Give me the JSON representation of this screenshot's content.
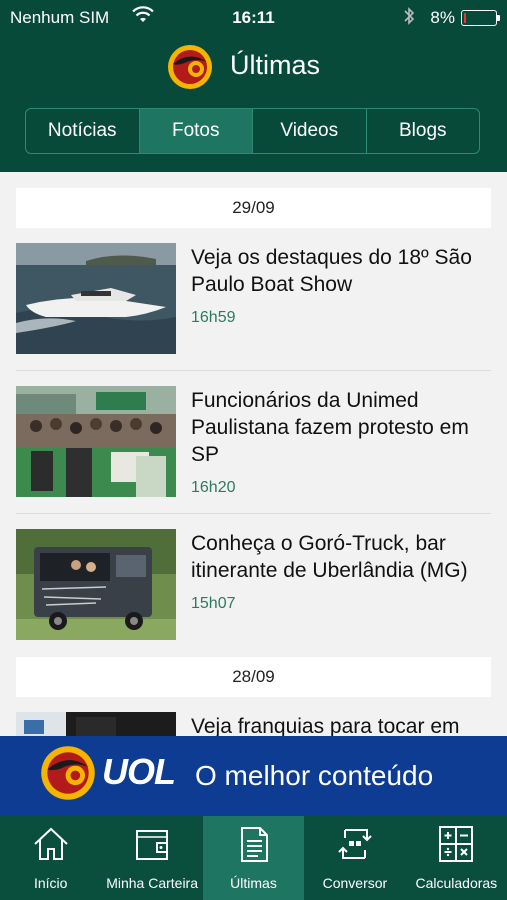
{
  "status_bar": {
    "carrier": "Nenhum SIM",
    "time": "16:11",
    "battery": "8%",
    "battery_level": 0.08
  },
  "header": {
    "title": "Últimas",
    "tabs": [
      {
        "label": "Notícias",
        "active": false
      },
      {
        "label": "Fotos",
        "active": true
      },
      {
        "label": "Videos",
        "active": false
      },
      {
        "label": "Blogs",
        "active": false
      }
    ]
  },
  "feed": [
    {
      "date": "29/09",
      "items": [
        {
          "title": "Veja os destaques do 18º São Paulo Boat Show",
          "time": "16h59"
        },
        {
          "title": "Funcionários da Unimed Paulistana fazem protesto em SP",
          "time": "16h20"
        },
        {
          "title": "Conheça o Goró-Truck, bar itinerante de Uberlândia (MG)",
          "time": "15h07"
        }
      ]
    },
    {
      "date": "28/09",
      "items": [
        {
          "title": "Veja franquias para tocar em",
          "time": ""
        }
      ]
    }
  ],
  "banner": {
    "brand": "UOL",
    "tagline": "O melhor conteúdo"
  },
  "bottom_nav": [
    {
      "label": "Início",
      "icon": "home-icon",
      "active": false
    },
    {
      "label": "Minha Carteira",
      "icon": "wallet-icon",
      "active": false
    },
    {
      "label": "Últimas",
      "icon": "document-icon",
      "active": true
    },
    {
      "label": "Conversor",
      "icon": "converter-icon",
      "active": false
    },
    {
      "label": "Calculadoras",
      "icon": "calculator-icon",
      "active": false
    }
  ],
  "colors": {
    "header_bg": "#084a3a",
    "accent": "#1e7561",
    "time_text": "#2c7a64",
    "banner_bg": "#0d3c92"
  }
}
